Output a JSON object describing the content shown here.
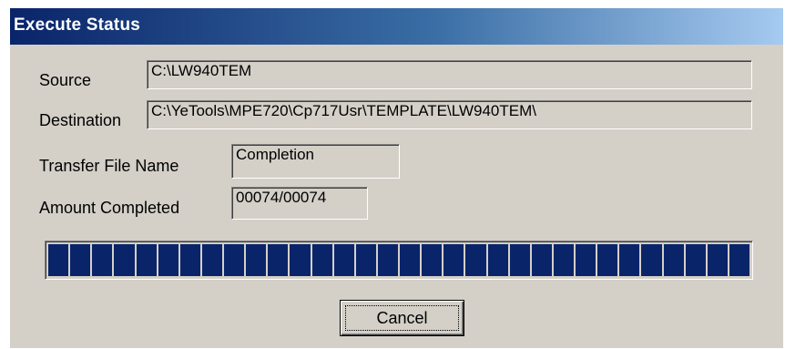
{
  "window": {
    "title": "Execute Status"
  },
  "fields": {
    "source_label": "Source",
    "source_value": "C:\\LW940TEM",
    "destination_label": "Destination",
    "destination_value": "C:\\YeTools\\MPE720\\Cp717Usr\\TEMPLATE\\LW940TEM\\",
    "transfer_label": "Transfer File Name",
    "transfer_value": "Completion",
    "amount_label": "Amount Completed",
    "amount_value": "00074/00074"
  },
  "progress": {
    "fraction": 1.0,
    "color": "#0a246a"
  },
  "buttons": {
    "cancel_label": "Cancel"
  },
  "colors": {
    "dialog_face": "#d4d0c8",
    "title_gradient_start": "#0a246a",
    "title_gradient_end": "#a6caf0"
  }
}
